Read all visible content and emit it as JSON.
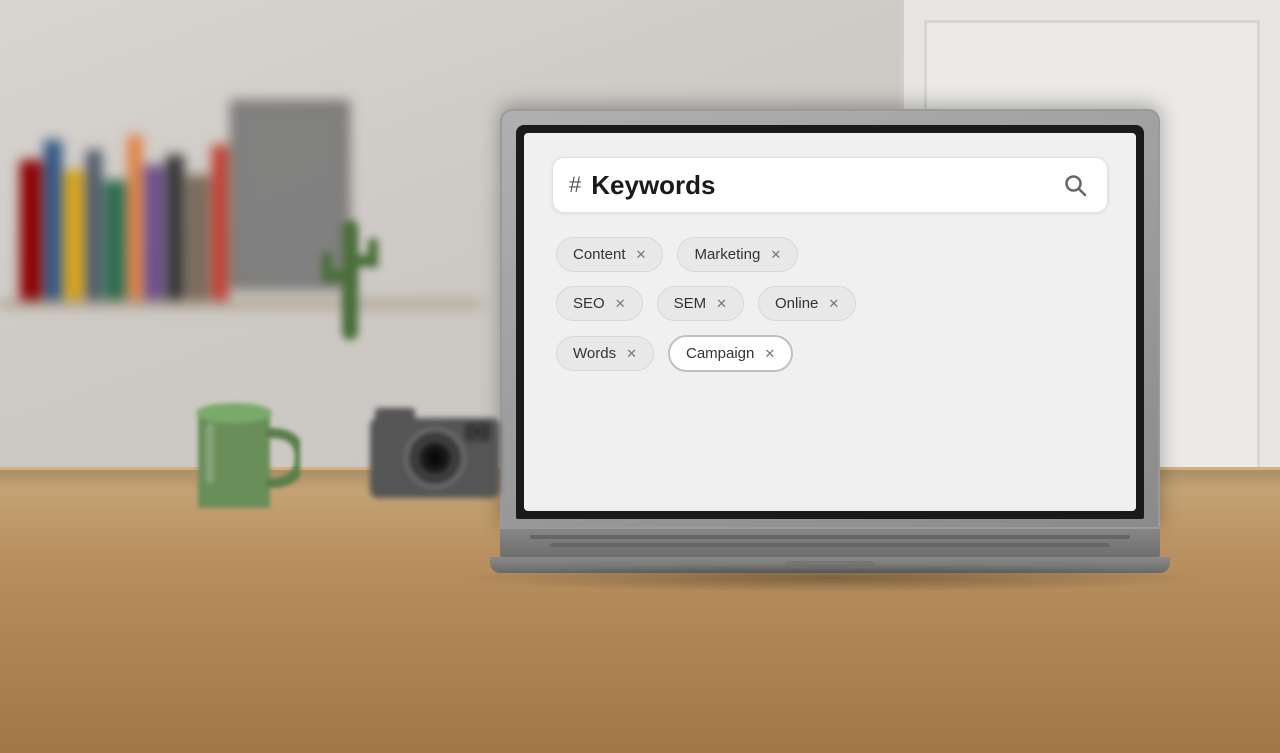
{
  "scene": {
    "wall_color": "#d0c9c0",
    "desk_color": "#c8a87a"
  },
  "laptop": {
    "screen": {
      "search_bar": {
        "hash_symbol": "#",
        "placeholder": "Keywords",
        "search_icon": "search-icon"
      },
      "tags": [
        {
          "row": 1,
          "items": [
            {
              "label": "Content",
              "close": "x",
              "selected": false
            },
            {
              "label": "Marketing",
              "close": "x",
              "selected": false
            }
          ]
        },
        {
          "row": 2,
          "items": [
            {
              "label": "SEO",
              "close": "x",
              "selected": false
            },
            {
              "label": "SEM",
              "close": "x",
              "selected": false
            },
            {
              "label": "Online",
              "close": "x",
              "selected": false
            }
          ]
        },
        {
          "row": 3,
          "items": [
            {
              "label": "Words",
              "close": "x",
              "selected": false
            },
            {
              "label": "Campaign",
              "close": "x",
              "selected": true
            }
          ]
        }
      ]
    }
  }
}
